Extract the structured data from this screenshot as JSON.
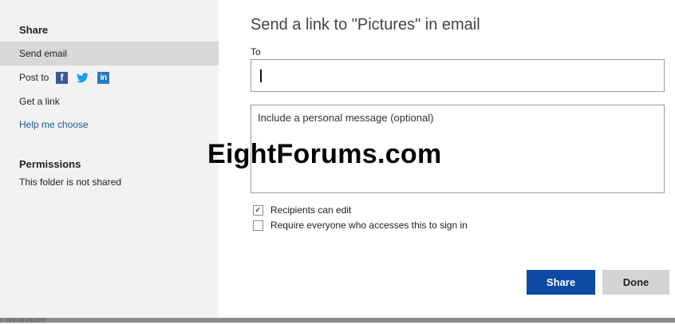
{
  "background": {
    "behind_text": "is available"
  },
  "sidebar": {
    "share_heading": "Share",
    "items": [
      {
        "label": "Send email"
      },
      {
        "label": "Post to"
      },
      {
        "label": "Get a link"
      },
      {
        "label": "Help me choose"
      }
    ],
    "social_icons": {
      "facebook": "f",
      "twitter": "🐦",
      "linkedin": "in"
    },
    "permissions_heading": "Permissions",
    "permissions_text": "This folder is not shared"
  },
  "main": {
    "title": "Send a link to \"Pictures\" in email",
    "to_label": "To",
    "to_value": "",
    "message_placeholder": "Include a personal message (optional)",
    "watermark": "EightForums.com",
    "checkboxes": [
      {
        "label": "Recipients can edit",
        "checked": true
      },
      {
        "label": "Require everyone who accesses this to sign in",
        "checked": false
      }
    ],
    "share_button": "Share",
    "done_button": "Done"
  },
  "colors": {
    "accent": "#0c4aa6",
    "link": "#1a5a96",
    "sidebar_bg": "#f2f2f2",
    "selected_bg": "#d8d8d8",
    "facebook": "#3b5998",
    "twitter": "#1da1f2",
    "linkedin": "#2a7ab9"
  }
}
